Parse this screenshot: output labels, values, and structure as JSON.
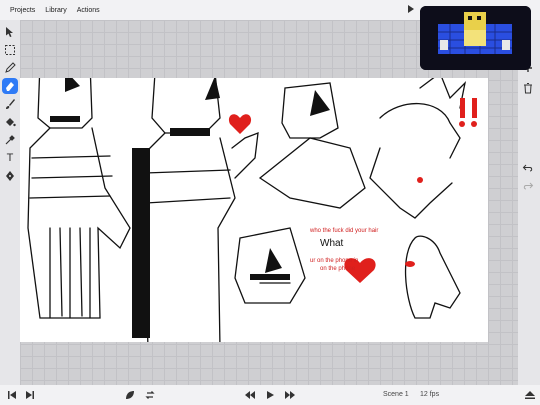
{
  "menu": [
    "Projects",
    "Library",
    "Actions"
  ],
  "tools": [
    {
      "name": "select-arrow-icon"
    },
    {
      "name": "marquee-select-icon"
    },
    {
      "name": "pencil-icon"
    },
    {
      "name": "eraser-icon",
      "active": true
    },
    {
      "name": "brush-icon"
    },
    {
      "name": "fill-bucket-icon"
    },
    {
      "name": "eyedropper-icon"
    },
    {
      "name": "text-tool-icon"
    },
    {
      "name": "pen-tool-icon"
    }
  ],
  "text_tool_glyph": "T",
  "canvas": {
    "note_line1": "who the fuck did your hair",
    "what_text": "What",
    "note_line2": "ur on the phone in",
    "note_line3": "on the phone"
  },
  "bottom": {
    "scene": "Scene 1",
    "fps": "12 fps"
  },
  "colors": {
    "accent": "#2f7bf6",
    "heart": "#e0201c",
    "ink": "#111111"
  }
}
